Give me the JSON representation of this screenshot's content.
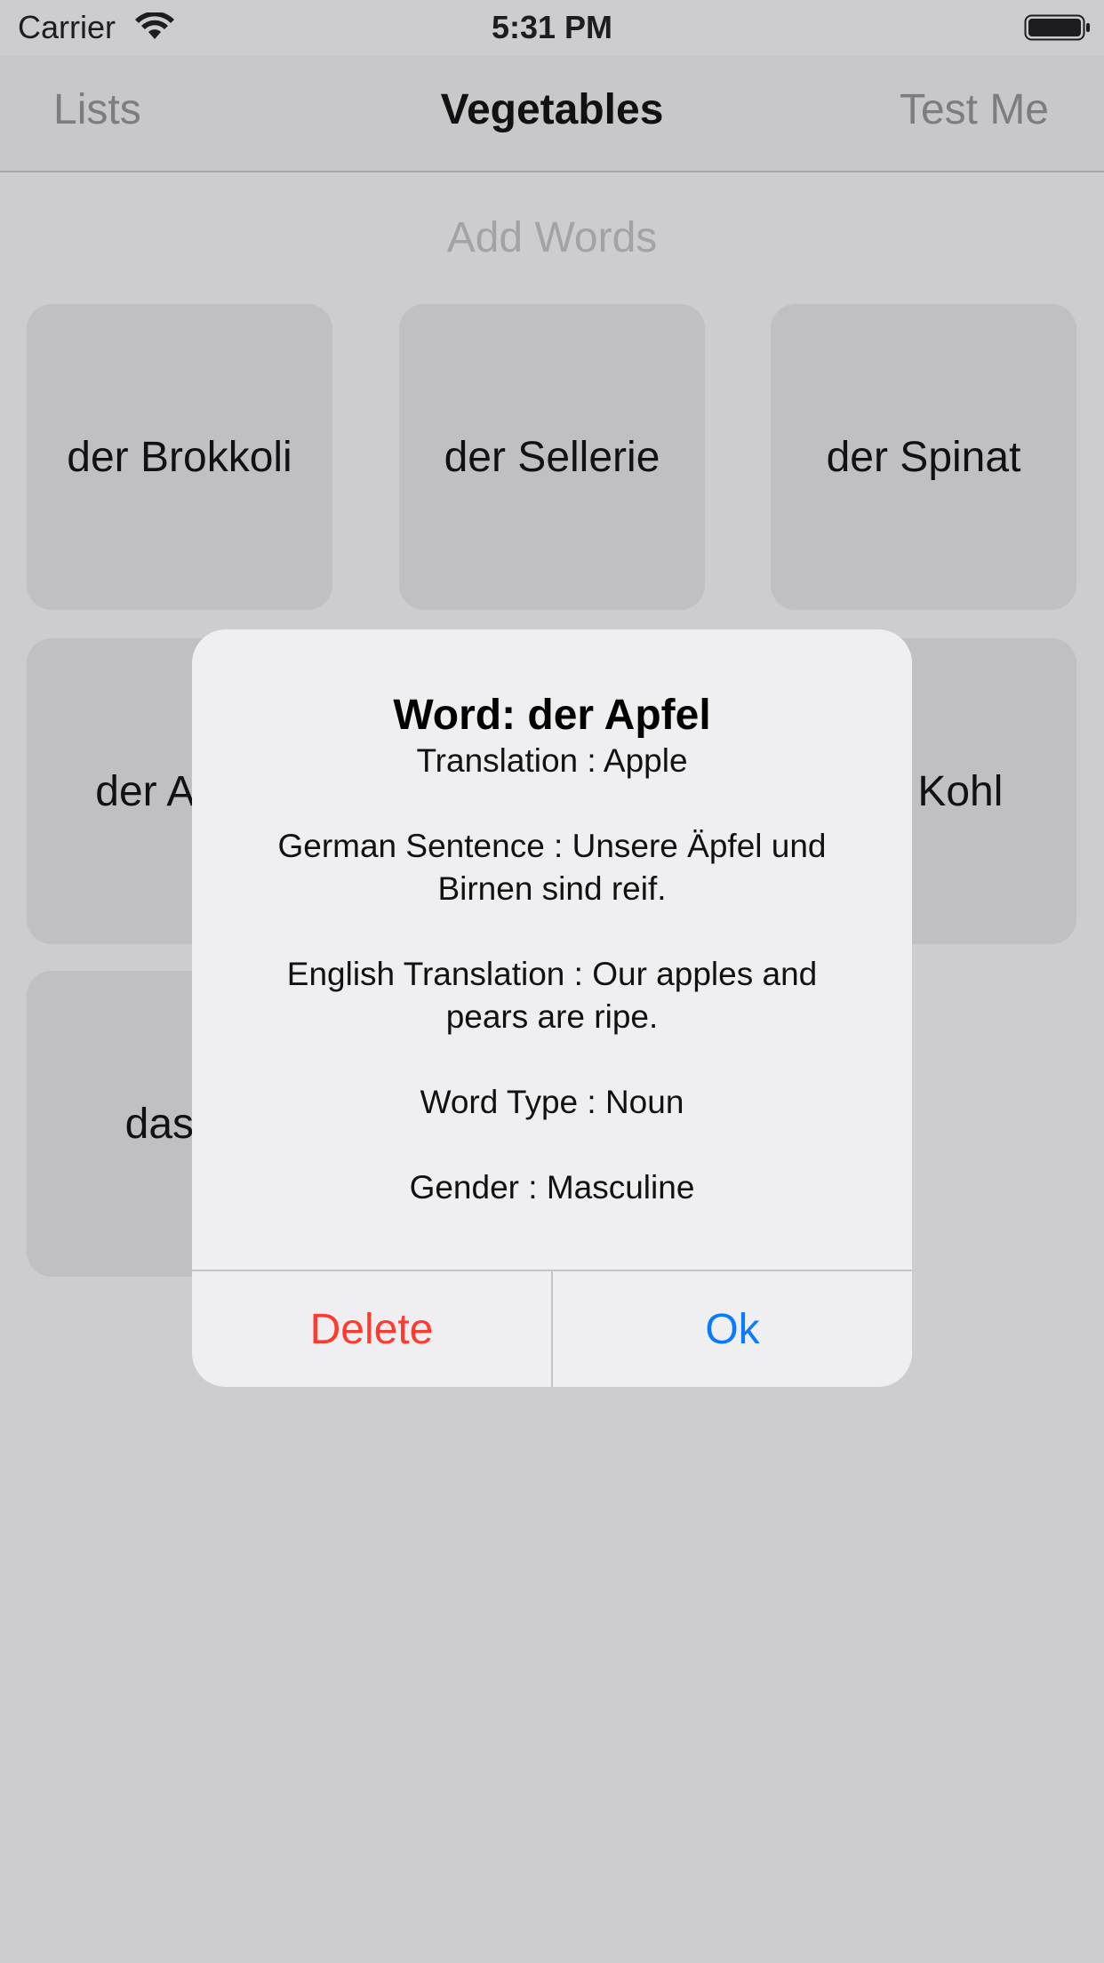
{
  "status_bar": {
    "carrier": "Carrier",
    "time": "5:31 PM"
  },
  "nav": {
    "back_label": "Lists",
    "title": "Vegetables",
    "action_label": "Test Me"
  },
  "add_words_label": "Add Words",
  "words": [
    "der Brokkoli",
    "der Sellerie",
    "der Spinat",
    "der Apfel",
    "der Kohl",
    "das B"
  ],
  "alert": {
    "title": "Word: der Apfel",
    "translation": "Translation : Apple",
    "german_sentence": "German Sentence : Unsere Äpfel und Birnen sind reif.",
    "english_translation": "English Translation : Our apples and pears are ripe.",
    "word_type": "Word Type : Noun",
    "gender": "Gender : Masculine",
    "delete_label": "Delete",
    "ok_label": "Ok"
  },
  "colors": {
    "destructive": "#ff3b30",
    "accent": "#0a7aff"
  }
}
